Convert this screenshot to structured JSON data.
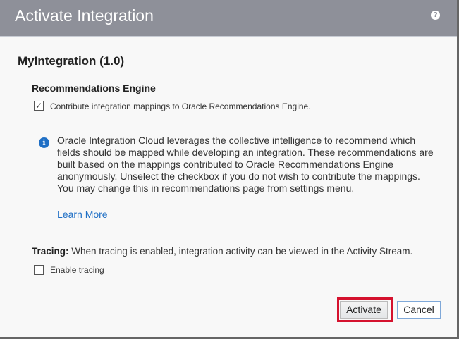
{
  "dialog": {
    "title": "Activate Integration",
    "help_icon": "question-circle-icon"
  },
  "integration_name": "MyIntegration (1.0)",
  "recommendations": {
    "heading": "Recommendations Engine",
    "checkbox_label": "Contribute integration mappings to Oracle Recommendations Engine.",
    "checked": true,
    "info_text": "Oracle Integration Cloud leverages the collective intelligence to recommend which fields should be mapped while developing an integration. These recommendations are built based on the mappings contributed to Oracle Recommendations Engine anonymously. Unselect the checkbox if you do not wish to contribute the mappings. You may change this in recommendations page from settings menu.",
    "learn_more": "Learn More"
  },
  "tracing": {
    "label": "Tracing:",
    "description": "When tracing is enabled, integration activity can be viewed in the Activity Stream.",
    "checkbox_label": "Enable tracing",
    "checked": false
  },
  "buttons": {
    "activate": "Activate",
    "cancel": "Cancel"
  },
  "colors": {
    "header": "#8e9099",
    "link": "#1f6fc5",
    "highlight": "#d5122e"
  }
}
